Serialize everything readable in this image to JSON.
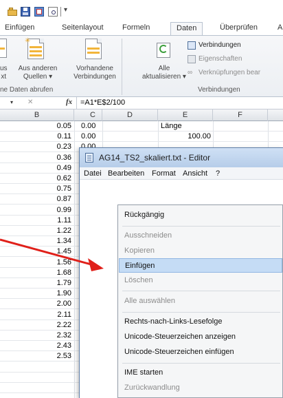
{
  "qat": {
    "icons": [
      "open-folder-icon",
      "save-icon",
      "export-pdf-icon",
      "print-preview-icon"
    ],
    "more": "|▾"
  },
  "tabs": [
    "Einfügen",
    "Seitenlayout",
    "Formeln",
    "Daten",
    "Überprüfen",
    "A"
  ],
  "active_tab": "Daten",
  "ribbon": {
    "from_access_left": [
      "us",
      "xt"
    ],
    "other_sources": [
      "Aus anderen",
      "Quellen ▾"
    ],
    "existing_connections": [
      "Vorhandene",
      "Verbindungen"
    ],
    "refresh_all": [
      "Alle",
      "aktualisieren ▾"
    ],
    "connections": "Verbindungen",
    "properties": "Eigenschaften",
    "edit_links": "Verknüpfungen bear",
    "group_external": "ne Daten abrufen",
    "group_connections": "Verbindungen"
  },
  "formula_bar": {
    "namebox_arrow": "▾",
    "cancel": "✕",
    "fx": "fx",
    "formula": "=A1*E$2/100"
  },
  "columns": [
    "B",
    "C",
    "D",
    "E",
    "F"
  ],
  "cells": {
    "b_values": [
      "0.05",
      "0.11",
      "0.23",
      "0.36",
      "0.49",
      "0.62",
      "0.75",
      "0.87",
      "0.99",
      "1.11",
      "1.22",
      "1.34",
      "1.45",
      "1.56",
      "1.68",
      "1.79",
      "1.90",
      "2.00",
      "2.11",
      "2.22",
      "2.32",
      "2.43",
      "2.53"
    ],
    "c_values": [
      "0.00",
      "0.00",
      "0.00"
    ],
    "e1": "Länge",
    "e2": "100.00"
  },
  "notepad": {
    "title": "AG14_TS2_skaliert.txt - Editor",
    "menu": [
      "Datei",
      "Bearbeiten",
      "Format",
      "Ansicht",
      "?"
    ]
  },
  "context_menu": {
    "undo": "Rückgängig",
    "cut": "Ausschneiden",
    "copy": "Kopieren",
    "paste": "Einfügen",
    "delete": "Löschen",
    "select_all": "Alle auswählen",
    "rtl": "Rechts-nach-Links-Lesefolge",
    "show_unicode": "Unicode-Steuerzeichen anzeigen",
    "insert_unicode": "Unicode-Steuerzeichen einfügen",
    "ime_open": "IME starten",
    "reconversion": "Zurückwandlung"
  },
  "colors": {
    "arrow": "#e0201a",
    "highlight": "#c5dcf5"
  }
}
